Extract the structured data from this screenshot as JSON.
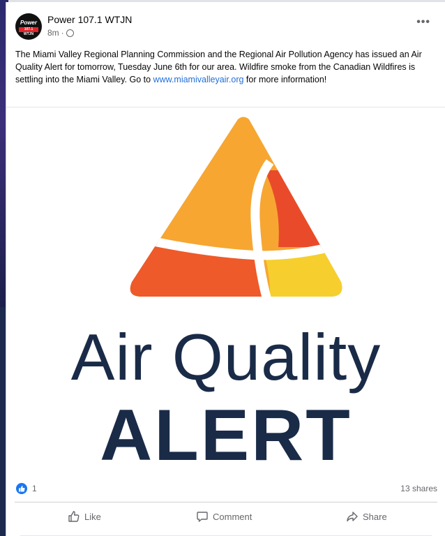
{
  "post": {
    "page_name": "Power 107.1 WTJN",
    "time": "8m",
    "more_label": "•••",
    "text_before_link": "The Miami Valley Regional Planning Commission and the Regional Air Pollution Agency has issued an Air Quality Alert for tomorrow, Tuesday June 6th for our area. Wildfire smoke from the Canadian Wildfires is settling into the Miami Valley. Go to ",
    "link": "www.miamivalleyair.org",
    "text_after_link": " for more information!"
  },
  "avatar": {
    "logo_word": "Power",
    "logo_sub": "107.1 WTJN"
  },
  "graphic": {
    "line1": "Air Quality",
    "line2": "ALERT",
    "colors": {
      "orange_light": "#f7a632",
      "orange_red": "#ee5a2a",
      "red": "#e94b2a",
      "yellow": "#f6cf2e",
      "navy": "#1a2b48"
    }
  },
  "engagement": {
    "reaction_count": "1",
    "shares": "13 shares"
  },
  "actions": {
    "like": "Like",
    "comment": "Comment",
    "share": "Share"
  }
}
